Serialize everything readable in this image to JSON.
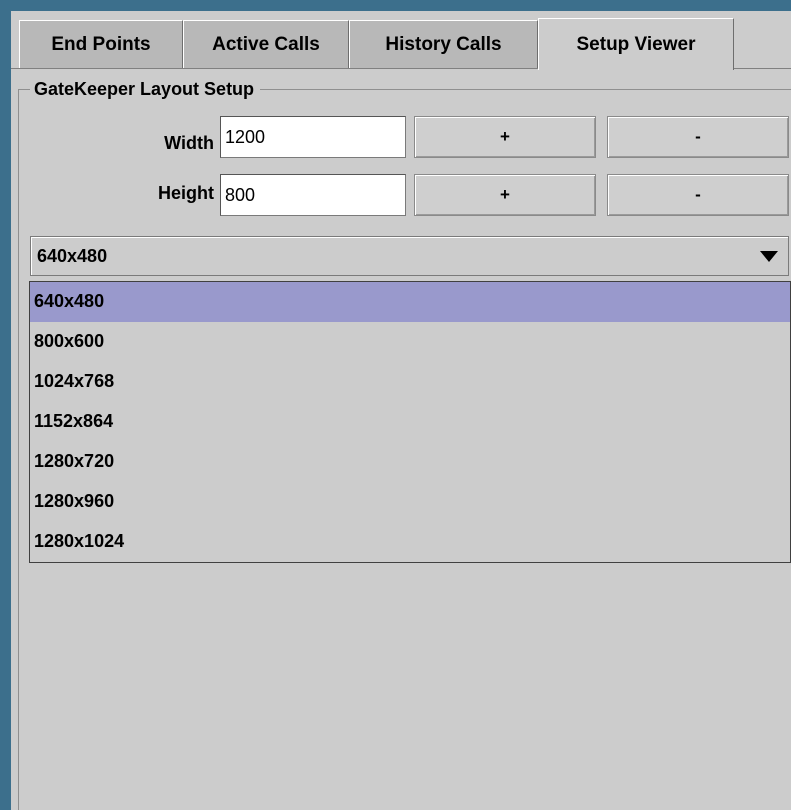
{
  "tabs": [
    {
      "label": "End Points"
    },
    {
      "label": "Active Calls"
    },
    {
      "label": "History Calls"
    },
    {
      "label": "Setup Viewer",
      "active": true
    }
  ],
  "layout_setup": {
    "group_title": "GateKeeper Layout Setup",
    "width": {
      "label": "Width",
      "value": "1200",
      "plus": "+",
      "minus": "-"
    },
    "height": {
      "label": "Height",
      "value": "800",
      "plus": "+",
      "minus": "-"
    }
  },
  "resolution_combo": {
    "selected": "640x480",
    "options": [
      "640x480",
      "800x600",
      "1024x768",
      "1152x864",
      "1280x720",
      "1280x960",
      "1280x1024"
    ],
    "highlighted_index": 0
  },
  "colors": {
    "frame": "#3c6f8c",
    "background": "#cccccc",
    "highlight": "#9999cc"
  }
}
